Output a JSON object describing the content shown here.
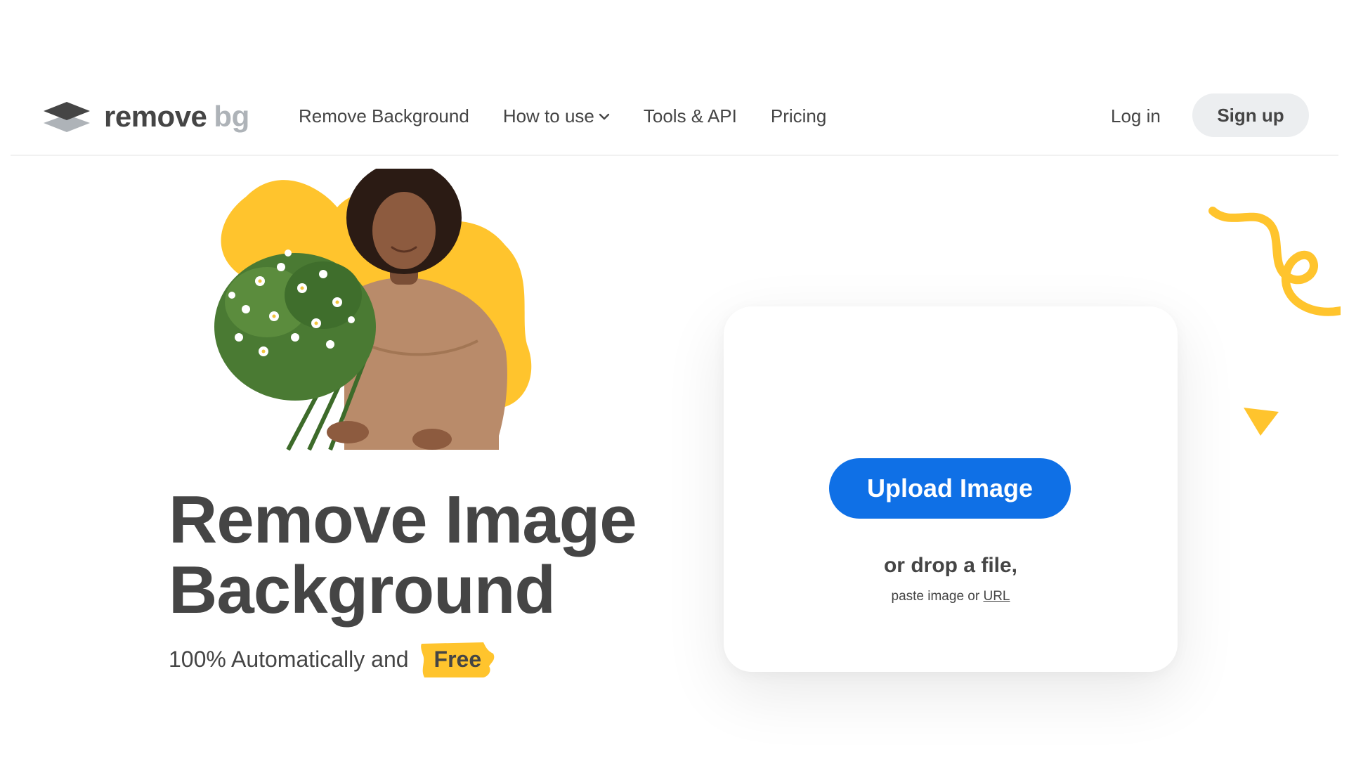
{
  "header": {
    "logo": {
      "word": "remove",
      "suffix": "bg"
    },
    "nav": [
      {
        "label": "Remove Background"
      },
      {
        "label": "How to use",
        "has_dropdown": true
      },
      {
        "label": "Tools & API"
      },
      {
        "label": "Pricing"
      }
    ],
    "login_label": "Log in",
    "signup_label": "Sign up"
  },
  "hero": {
    "title_line1": "Remove Image",
    "title_line2": "Background",
    "subtitle": "100% Automatically and",
    "badge": "Free"
  },
  "upload": {
    "button_label": "Upload Image",
    "drop_text": "or drop a file,",
    "paste_text": "paste image or",
    "url_link": "URL"
  },
  "colors": {
    "accent_blue": "#0f70e6",
    "accent_yellow": "#ffc42d",
    "text": "#454545",
    "signup_bg": "#eceef0"
  },
  "icons": [
    "logo-layers-icon",
    "chevron-down-icon",
    "squiggle-decoration",
    "triangle-decoration"
  ]
}
